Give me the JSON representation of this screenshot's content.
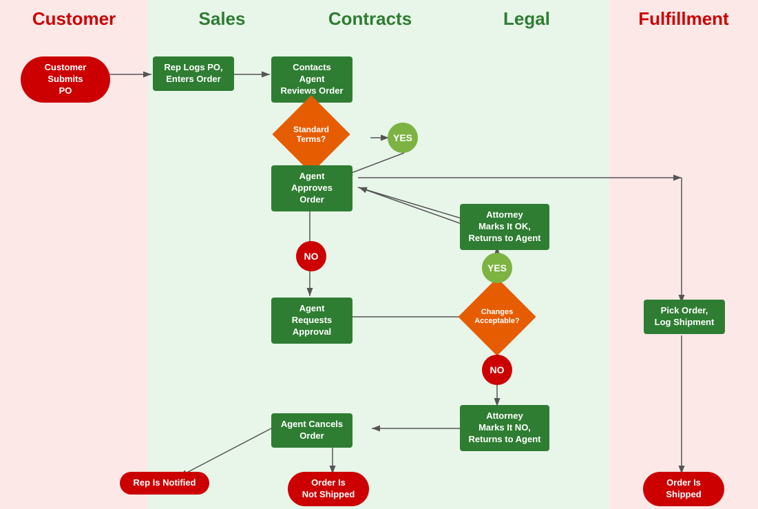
{
  "lanes": [
    {
      "id": "customer",
      "label": "Customer"
    },
    {
      "id": "sales",
      "label": "Sales"
    },
    {
      "id": "contracts",
      "label": "Contracts"
    },
    {
      "id": "legal",
      "label": "Legal"
    },
    {
      "id": "fulfillment",
      "label": "Fulfillment"
    }
  ],
  "nodes": {
    "customer_submits_po": "Customer Submits\nPO",
    "rep_logs_po": "Rep Logs PO,\nEnters Order",
    "contacts_agent": "Contacts Agent\nReviews Order",
    "standard_terms": "Standard\nTerms?",
    "yes1": "YES",
    "agent_approves": "Agent Approves\nOrder",
    "no1": "NO",
    "agent_requests": "Agent Requests\nApproval",
    "changes_acceptable": "Changes\nAcceptable?",
    "yes2": "YES",
    "no2": "NO",
    "attorney_ok": "Attorney\nMarks It OK,\nReturns to Agent",
    "attorney_no": "Attorney\nMarks It NO,\nReturns to Agent",
    "agent_cancels": "Agent Cancels\nOrder",
    "pick_order": "Pick Order,\nLog Shipment",
    "rep_is_notified": "Rep Is Notified",
    "order_not_shipped": "Order Is\nNot Shipped",
    "order_is_shipped": "Order Is Shipped"
  }
}
